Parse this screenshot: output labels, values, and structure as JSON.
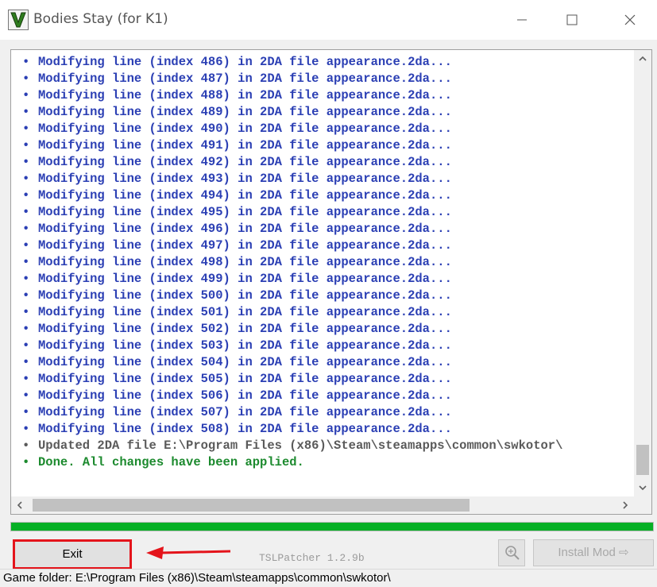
{
  "window": {
    "title": "Bodies Stay (for K1)",
    "app_icon_letter": "V"
  },
  "log": {
    "lines": [
      {
        "text": "Modifying line (index 486) in 2DA file appearance.2da...",
        "color": "blue"
      },
      {
        "text": "Modifying line (index 487) in 2DA file appearance.2da...",
        "color": "blue"
      },
      {
        "text": "Modifying line (index 488) in 2DA file appearance.2da...",
        "color": "blue"
      },
      {
        "text": "Modifying line (index 489) in 2DA file appearance.2da...",
        "color": "blue"
      },
      {
        "text": "Modifying line (index 490) in 2DA file appearance.2da...",
        "color": "blue"
      },
      {
        "text": "Modifying line (index 491) in 2DA file appearance.2da...",
        "color": "blue"
      },
      {
        "text": "Modifying line (index 492) in 2DA file appearance.2da...",
        "color": "blue"
      },
      {
        "text": "Modifying line (index 493) in 2DA file appearance.2da...",
        "color": "blue"
      },
      {
        "text": "Modifying line (index 494) in 2DA file appearance.2da...",
        "color": "blue"
      },
      {
        "text": "Modifying line (index 495) in 2DA file appearance.2da...",
        "color": "blue"
      },
      {
        "text": "Modifying line (index 496) in 2DA file appearance.2da...",
        "color": "blue"
      },
      {
        "text": "Modifying line (index 497) in 2DA file appearance.2da...",
        "color": "blue"
      },
      {
        "text": "Modifying line (index 498) in 2DA file appearance.2da...",
        "color": "blue"
      },
      {
        "text": "Modifying line (index 499) in 2DA file appearance.2da...",
        "color": "blue"
      },
      {
        "text": "Modifying line (index 500) in 2DA file appearance.2da...",
        "color": "blue"
      },
      {
        "text": "Modifying line (index 501) in 2DA file appearance.2da...",
        "color": "blue"
      },
      {
        "text": "Modifying line (index 502) in 2DA file appearance.2da...",
        "color": "blue"
      },
      {
        "text": "Modifying line (index 503) in 2DA file appearance.2da...",
        "color": "blue"
      },
      {
        "text": "Modifying line (index 504) in 2DA file appearance.2da...",
        "color": "blue"
      },
      {
        "text": "Modifying line (index 505) in 2DA file appearance.2da...",
        "color": "blue"
      },
      {
        "text": "Modifying line (index 506) in 2DA file appearance.2da...",
        "color": "blue"
      },
      {
        "text": "Modifying line (index 507) in 2DA file appearance.2da...",
        "color": "blue"
      },
      {
        "text": "Modifying line (index 508) in 2DA file appearance.2da...",
        "color": "blue"
      },
      {
        "text": "Updated 2DA file E:\\Program Files (x86)\\Steam\\steamapps\\common\\swkotor\\",
        "color": "dark"
      },
      {
        "text": "Done. All changes have been applied.",
        "color": "green"
      }
    ],
    "bullet": "•"
  },
  "progress": {
    "value": 1.0
  },
  "buttons": {
    "exit_label": "Exit",
    "install_label": "Install Mod ⇨",
    "install_enabled": false
  },
  "version_label": "TSLPatcher 1.2.9b",
  "status_bar": {
    "text": "Game folder: E:\\Program Files (x86)\\Steam\\steamapps\\common\\swkotor\\"
  },
  "colors": {
    "log_blue": "#2b3fb4",
    "log_dark": "#5a5a5a",
    "log_green": "#1c8a2e",
    "progress": "#06b025",
    "annotation_red": "#e4141b"
  },
  "icons": {
    "app": "tslpatcher-v-icon",
    "minimize": "minimize-icon",
    "maximize": "maximize-icon",
    "close": "close-icon",
    "zoom": "magnifier-icon",
    "annotation": "red-arrow-pointing-left"
  }
}
